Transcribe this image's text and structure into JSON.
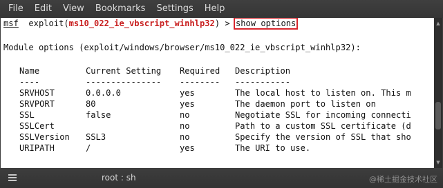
{
  "menu": [
    "File",
    "Edit",
    "View",
    "Bookmarks",
    "Settings",
    "Help"
  ],
  "terminal": {
    "prompt_prefix": "msf",
    "prompt_mid": "  exploit(",
    "module_name": "ms10_022_ie_vbscript_winhlp32",
    "prompt_suffix": ") > ",
    "command": "show options",
    "options_header": "Module options (exploit/windows/browser/ms10_022_ie_vbscript_winhlp32):",
    "columns": [
      "Name",
      "Current Setting",
      "Required",
      "Description"
    ],
    "separators": [
      "----",
      "---------------",
      "--------",
      "-----------"
    ],
    "rows": [
      {
        "name": "SRVHOST",
        "setting": "0.0.0.0",
        "required": "yes",
        "description": "The local host to listen on. This m"
      },
      {
        "name": "SRVPORT",
        "setting": "80",
        "required": "yes",
        "description": "The daemon port to listen on"
      },
      {
        "name": "SSL",
        "setting": "false",
        "required": "no",
        "description": "Negotiate SSL for incoming connecti"
      },
      {
        "name": "SSLCert",
        "setting": "",
        "required": "no",
        "description": "Path to a custom SSL certificate (d"
      },
      {
        "name": "SSLVersion",
        "setting": "SSL3",
        "required": "no",
        "description": "Specify the version of SSL that sho"
      },
      {
        "name": "URIPATH",
        "setting": "/",
        "required": "yes",
        "description": "The URI to use."
      }
    ]
  },
  "status": {
    "title": "root : sh",
    "watermark": "@稀土掘金技术社区"
  },
  "colors": {
    "highlight": "#d8262d",
    "module": "#c81e1e"
  }
}
